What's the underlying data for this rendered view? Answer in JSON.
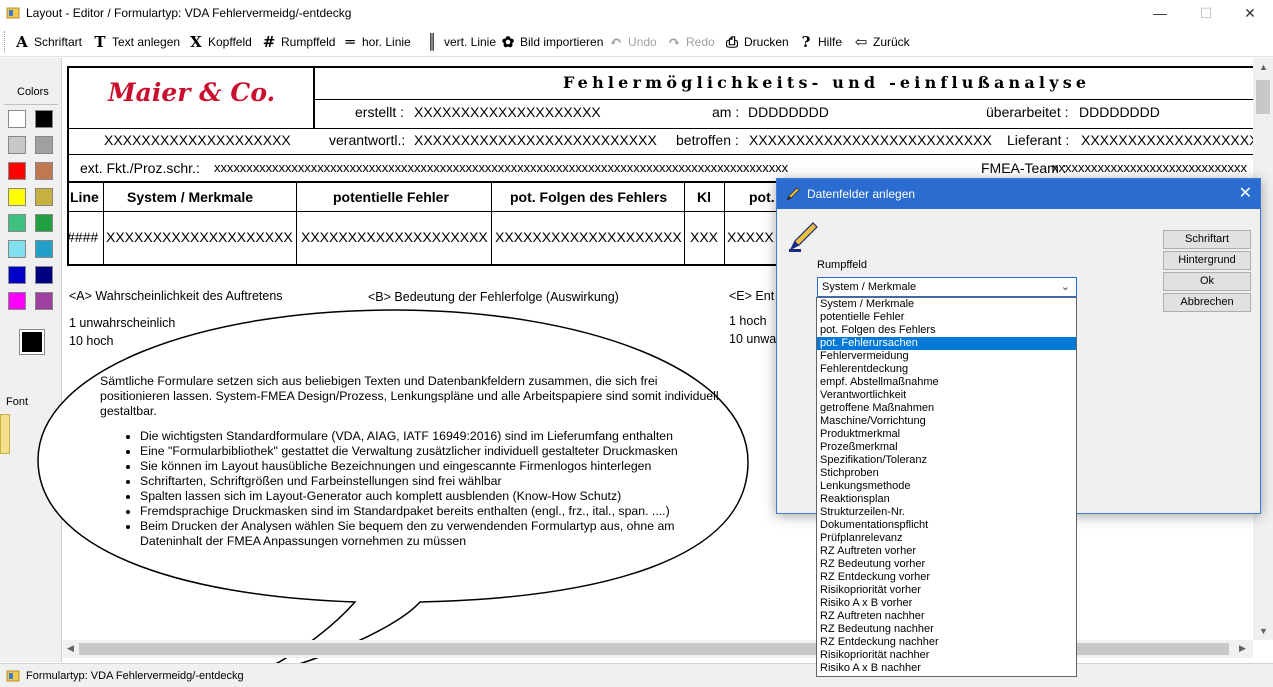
{
  "window": {
    "title": "Layout - Editor  /  Formulartyp: VDA Fehlervermeidg/-entdeckg",
    "minimize": "—",
    "maximize": "☐",
    "close": "✕"
  },
  "toolbar": [
    {
      "icon": "A",
      "label": "Schriftart",
      "name": "schriftart-button",
      "disabled": false
    },
    {
      "icon": "T",
      "label": "Text anlegen",
      "name": "text-anlegen-button",
      "disabled": false
    },
    {
      "icon": "X",
      "label": "Kopffeld",
      "name": "kopffeld-button",
      "disabled": false
    },
    {
      "icon": "#",
      "label": "Rumpffeld",
      "name": "rumpffeld-button",
      "disabled": false
    },
    {
      "icon": "═",
      "label": "hor. Linie",
      "name": "hor-linie-button",
      "disabled": false
    },
    {
      "icon": "║",
      "label": "vert. Linie",
      "name": "vert-linie-button",
      "disabled": false
    },
    {
      "icon": "✿",
      "label": "Bild importieren",
      "name": "bild-importieren-button",
      "disabled": false
    },
    {
      "icon": "↶",
      "label": "Undo",
      "name": "undo-button",
      "disabled": true
    },
    {
      "icon": "↷",
      "label": "Redo",
      "name": "redo-button",
      "disabled": true
    },
    {
      "icon": "⎙",
      "label": "Drucken",
      "name": "drucken-button",
      "disabled": false
    },
    {
      "icon": "?",
      "label": "Hilfe",
      "name": "hilfe-button",
      "disabled": false
    },
    {
      "icon": "⇦",
      "label": "Zurück",
      "name": "zurueck-button",
      "disabled": false
    }
  ],
  "left_panel": {
    "colors_label": "Colors",
    "font_label": "Font",
    "swatches": [
      "#ffffff",
      "#000000",
      "#c8c8c8",
      "#a0a0a0",
      "#ff0000",
      "#c07850",
      "#ffff00",
      "#c8b040",
      "#40c080",
      "#20a040",
      "#80e0f0",
      "#20a0c8",
      "#0000c8",
      "#000080",
      "#ff00ff",
      "#a040a0"
    ],
    "current_color": "#000000"
  },
  "form": {
    "logo": "Maier & Co.",
    "heading": "Fehlermöglichkeits- und -einflußanalyse",
    "erstellt_label": "erstellt :",
    "erstellt_value": "XXXXXXXXXXXXXXXXXXXX",
    "am_label": "am :",
    "am_value": "DDDDDDDD",
    "ueberarbeitet_label": "überarbeitet :",
    "ueberarbeitet_value": "DDDDDDDD",
    "left_field": "XXXXXXXXXXXXXXXXXXXX",
    "verantwortl_label": "verantwortl.:",
    "verantwortl_value": "XXXXXXXXXXXXXXXXXXXXXXXXXX",
    "betroffen_label": "betroffen :",
    "betroffen_value": "XXXXXXXXXXXXXXXXXXXXXXXXXX",
    "lieferant_label": "Lieferant :",
    "lieferant_value": "XXXXXXXXXXXXXXXXXXXXXXXX",
    "ext_label": "ext. Fkt./Proz.schr.:",
    "ext_value": "xxxxxxxxxxxxxxxxxxxxxxxxxxxxxxxxxxxxxxxxxxxxxxxxxxxxxxxxxxxxxxxxxxxxxxxxxxxxxxxxxxxxxxxxx",
    "fmea_label": "FMEA-Team :",
    "fmea_value": "xxxxxxxxxxxxxxxxxxxxxxxxxxxxxx",
    "columns": [
      "Line",
      "System / Merkmale",
      "potentielle Fehler",
      "pot. Folgen des Fehlers",
      "Kl",
      "pot."
    ],
    "row": [
      "####",
      "XXXXXXXXXXXXXXXXXXXX",
      "XXXXXXXXXXXXXXXXXXXX",
      "XXXXXXXXXXXXXXXXXXXX",
      "XXX",
      "XXXXX"
    ],
    "legend_a": "<A> Wahrscheinlichkeit des Auftretens",
    "legend_b": "<B> Bedeutung der Fehlerfolge (Auswirkung)",
    "legend_e": "<E> Ent",
    "a_low": "1 unwahrscheinlich",
    "a_high": "10 hoch",
    "e_low": "1 hoch",
    "e_high": "10 unwa"
  },
  "callout": {
    "intro": "Sämtliche Formulare setzen sich aus beliebigen Texten und Datenbankfeldern zusammen, die sich frei positionieren lassen. System-FMEA Design/Prozess, Lenkungspläne und alle Arbeitspapiere sind somit individuell gestaltbar.",
    "bullets": [
      "Die wichtigsten Standardformulare (VDA, AIAG, IATF 16949:2016) sind im Lieferumfang enthalten",
      "Eine \"Formularbibliothek\" gestattet die Verwaltung zusätzlicher individuell gestalteter Druckmasken",
      "Sie können im Layout hausübliche Bezeichnungen und eingescannte Firmenlogos hinterlegen",
      "Schriftarten, Schriftgrößen und Farbeinstellungen sind frei wählbar",
      "Spalten lassen sich im Layout-Generator auch komplett ausblenden (Know-How Schutz)",
      "Fremdsprachige Druckmasken sind im Standardpaket bereits enthalten (engl., frz., ital., span. ....)",
      "Beim Drucken der Analysen wählen Sie bequem den zu verwendenden Formulartyp aus, ohne am Dateninhalt der FMEA Anpassungen vornehmen zu müssen"
    ]
  },
  "dialog": {
    "title": "Datenfelder anlegen",
    "close": "✕",
    "field_label": "Rumpffeld",
    "combo_value": "System / Merkmale",
    "buttons": [
      "Schriftart",
      "Hintergrund",
      "Ok",
      "Abbrechen"
    ],
    "options": [
      "System / Merkmale",
      "potentielle Fehler",
      "pot. Folgen des Fehlers",
      "pot. Fehlerursachen",
      "Fehlervermeidung",
      "Fehlerentdeckung",
      "empf. Abstellmaßnahme",
      "Verantwortlichkeit",
      "getroffene Maßnahmen",
      "Maschine/Vorrichtung",
      "Produktmerkmal",
      "Prozeßmerkmal",
      "Spezifikation/Toleranz",
      "Stichproben",
      "Lenkungsmethode",
      "Reaktionsplan",
      "Strukturzeilen-Nr.",
      "Dokumentationspflicht",
      "Prüfplanrelevanz",
      "RZ Auftreten vorher",
      "RZ Bedeutung vorher",
      "RZ Entdeckung vorher",
      "Risikopriorität vorher",
      "Risiko A x B vorher",
      "RZ Auftreten nachher",
      "RZ Bedeutung nachher",
      "RZ Entdeckung nachher",
      "Risikopriorität nachher",
      "Risiko A x B nachher"
    ],
    "selected_index": 3
  },
  "status": {
    "text": "Formulartyp: VDA Fehlervermeidg/-entdeckg"
  }
}
